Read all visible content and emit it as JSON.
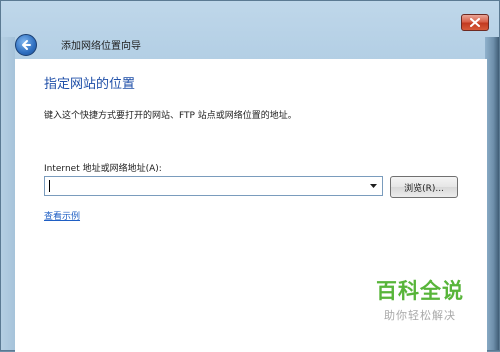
{
  "window": {
    "title": "添加网络位置向导"
  },
  "page": {
    "heading": "指定网站的位置",
    "description": "键入这个快捷方式要打开的网站、FTP 站点或网络位置的地址。",
    "field_label": "Internet 地址或网络地址(A):",
    "address_value": "",
    "browse_label": "浏览(R)...",
    "examples_link": "查看示例"
  },
  "watermark": {
    "brand": "百科全说",
    "tagline": "助你轻松解决"
  },
  "colors": {
    "heading": "#1f4fa8",
    "link": "#1f5fc4",
    "close_button": "#c23a20",
    "watermark_brand": "#58b53a"
  },
  "icons": {
    "back": "back-arrow-icon",
    "close": "close-icon",
    "dropdown": "chevron-down-icon"
  }
}
